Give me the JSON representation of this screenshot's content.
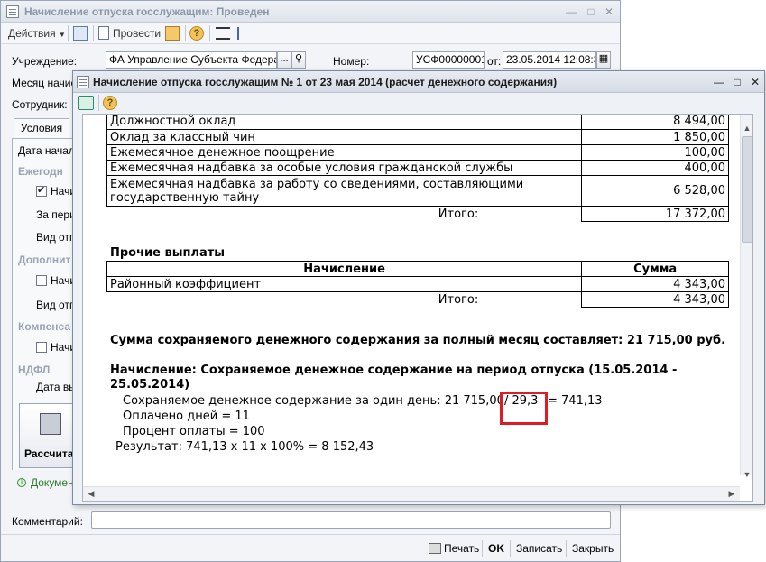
{
  "back_window": {
    "title": "Начисление отпуска госслужащим: Проведен",
    "toolbar": {
      "actions_label": "Действия",
      "post_label": "Провести"
    },
    "fields": {
      "institution_label": "Учреждение:",
      "institution_value": "ФА Управление Субъекта Федерац",
      "number_label": "Номер:",
      "number_value": "УСФ00000001",
      "from_label": "от:",
      "date_value": "23.05.2014 12:08:31",
      "month_label": "Месяц начис",
      "employee_label": "Сотрудник:"
    },
    "tabs": {
      "conditions": "Условия"
    },
    "left_panel": {
      "start_date_label": "Дата начал",
      "annual_group": "Ежегодн",
      "cb1_label": "Начи",
      "period_label": "За пери",
      "vacation_type_label": "Вид отп",
      "additional_group": "Дополнит",
      "cb2_label": "Начи",
      "vacation_type2_label": "Вид отп",
      "compensation_group": "Компенса",
      "cb3_label": "Начи",
      "ndfl_group": "НДФЛ",
      "pay_date_label": "Дата вы",
      "calc_button": "Рассчита",
      "document_link": "Докумен"
    },
    "comment_label": "Комментарий:",
    "bottom_buttons": {
      "print": "Печать",
      "ok": "OK",
      "save": "Записать",
      "close": "Закрыть"
    }
  },
  "front_window": {
    "title": "Начисление отпуска госслужащим № 1 от 23 мая 2014 (расчет денежного содержания)",
    "report": {
      "salary_rows": [
        {
          "name": "Должностной оклад",
          "value": "8 494,00"
        },
        {
          "name": "Оклад за классный чин",
          "value": "1 850,00"
        },
        {
          "name": "Ежемесячное денежное поощрение",
          "value": "100,00"
        },
        {
          "name": "Ежемесячная надбавка за особые условия гражданской службы",
          "value": "400,00"
        },
        {
          "name_line1": "Ежемесячная надбавка за работу со сведениями, составляющими",
          "name_line2": "государственную тайну",
          "value": "6 528,00"
        }
      ],
      "total_label": "Итого:",
      "salary_total": "17 372,00",
      "other_heading": "Прочие выплаты",
      "col_accrual": "Начисление",
      "col_sum": "Сумма",
      "other_rows": [
        {
          "name": "Районный коэффициент",
          "value": "4 343,00"
        }
      ],
      "other_total": "4 343,00",
      "summary": "Сумма сохраняемого денежного содержания за полный месяц составляет: 21 715,00 руб.",
      "accrual_heading_line1": "Начисление: Сохраняемое денежное содержание на период отпуска (15.05.2014 -",
      "accrual_heading_line2": "25.05.2014)",
      "daily_prefix": "Сохраняемое денежное содержание за один день: 21 715,00",
      "daily_divisor": "/ 29,3",
      "daily_result": "= 741,13",
      "days_paid": "Оплачено дней = 11",
      "pay_percent": "Процент оплаты = 100",
      "result": "Результат: 741,13 х 11 х 100% = 8 152,43"
    }
  }
}
